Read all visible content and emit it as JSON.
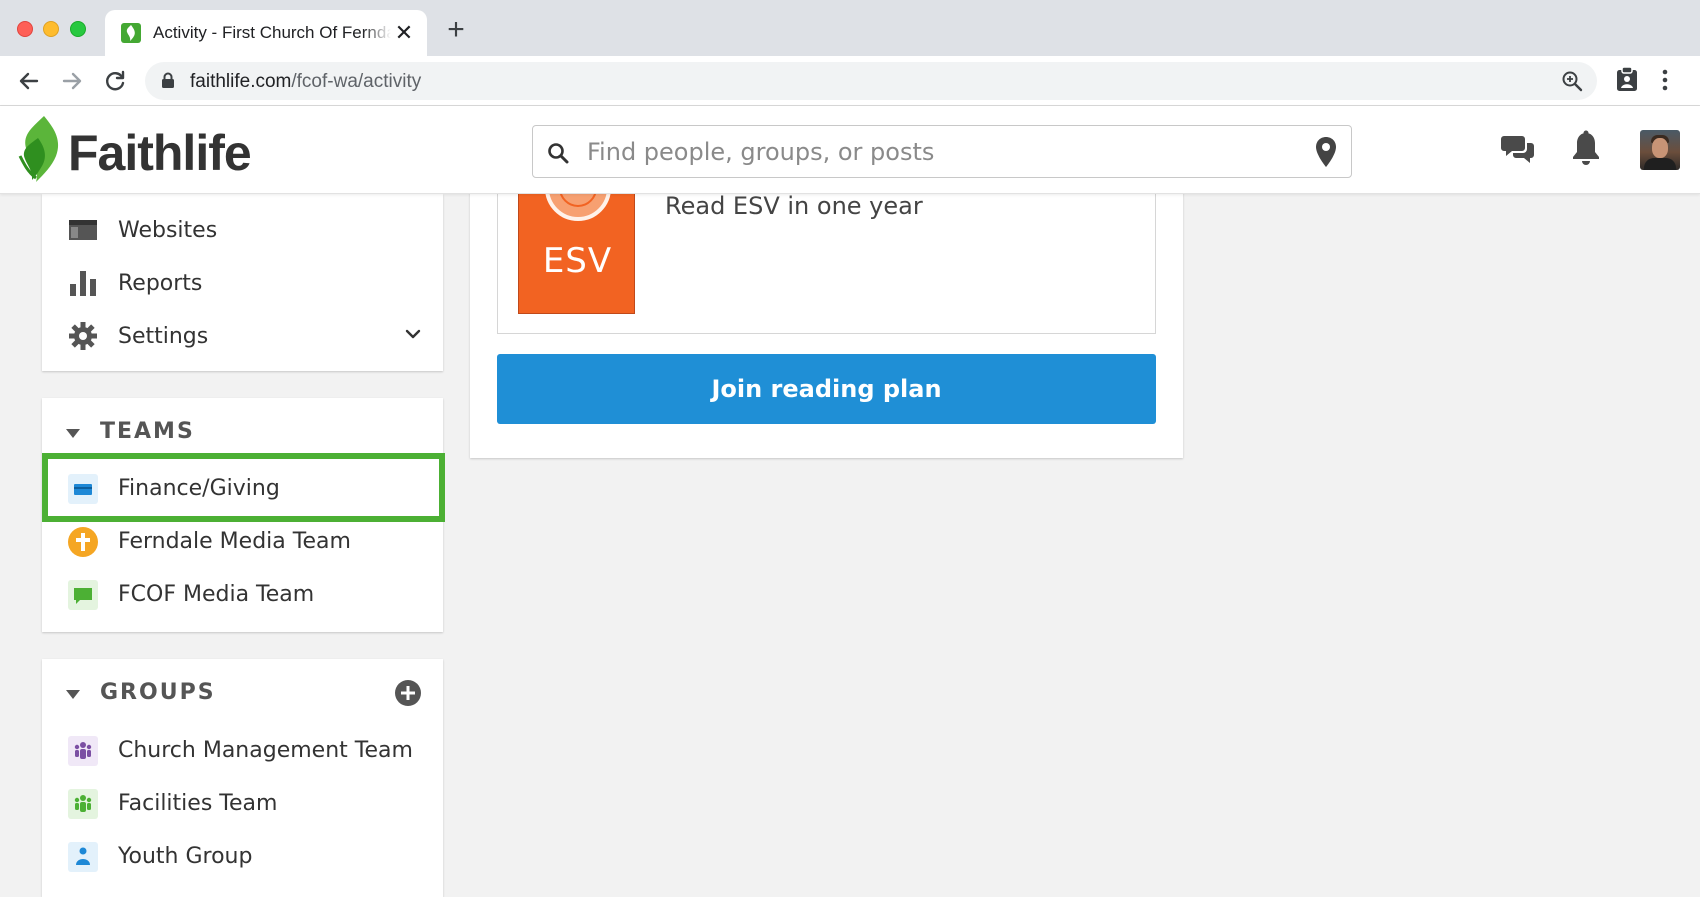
{
  "browser": {
    "tab_title": "Activity - First Church Of Ferndale",
    "tab_close": "✕",
    "new_tab": "+",
    "url_host": "faithlife.com",
    "url_path": "/fcof-wa/activity"
  },
  "header": {
    "logo_text": "Faithlife",
    "search_placeholder": "Find people, groups, or posts"
  },
  "sidebar": {
    "nav_items": [
      {
        "label": "Websites",
        "icon": "websites-icon"
      },
      {
        "label": "Reports",
        "icon": "bar-chart-icon"
      },
      {
        "label": "Settings",
        "icon": "gear-icon"
      }
    ],
    "teams": {
      "title": "TEAMS",
      "items": [
        {
          "label": "Finance/Giving",
          "icon": "credit-card-icon",
          "color": "#1e88d6"
        },
        {
          "label": "Ferndale Media Team",
          "icon": "cross-icon",
          "color": "#f5a623"
        },
        {
          "label": "FCOF Media Team",
          "icon": "chat-bubble-icon",
          "color": "#4cb034"
        }
      ]
    },
    "groups": {
      "title": "GROUPS",
      "items": [
        {
          "label": "Church Management Team",
          "icon": "people-icon",
          "color": "#7b4fa3"
        },
        {
          "label": "Facilities Team",
          "icon": "people-icon",
          "color": "#4cb034"
        },
        {
          "label": "Youth Group",
          "icon": "person-icon",
          "color": "#1e88d6"
        }
      ]
    }
  },
  "main": {
    "cover_label": "ESV",
    "plan_description": "Read ESV in one year",
    "join_button": "Join reading plan"
  },
  "colors": {
    "brand_green": "#4cb034",
    "primary_blue": "#1f8fd6",
    "esv_orange": "#f26322",
    "highlight": "#4cb034"
  }
}
